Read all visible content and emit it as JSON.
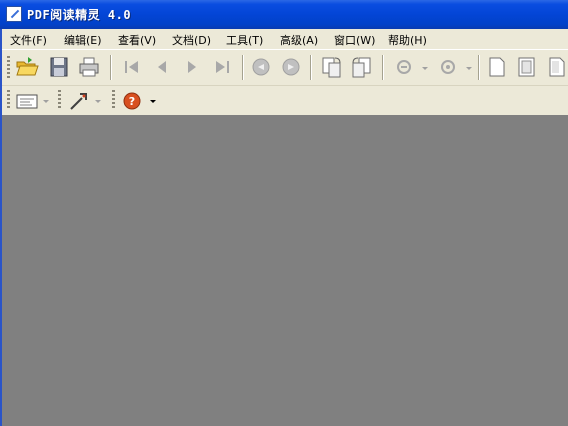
{
  "window": {
    "title": "PDF阅读精灵 4.0"
  },
  "menubar": {
    "items": [
      {
        "label": "文件(F)"
      },
      {
        "label": "编辑(E)"
      },
      {
        "label": "查看(V)"
      },
      {
        "label": "文档(D)"
      },
      {
        "label": "工具(T)"
      },
      {
        "label": "高级(A)"
      },
      {
        "label": "窗口(W)"
      },
      {
        "label": "帮助(H)"
      }
    ]
  },
  "icons": {
    "open": "folder-open-icon",
    "save": "save-icon",
    "print": "print-icon",
    "first_page": "first-page-icon",
    "prev_page": "prev-page-icon",
    "next_page": "next-page-icon",
    "last_page": "last-page-icon",
    "back": "back-icon",
    "forward": "forward-icon",
    "rotate_cw": "rotate-clockwise-icon",
    "rotate_ccw": "rotate-counterclockwise-icon",
    "zoom_out": "zoom-out-icon",
    "zoom_in": "zoom-in-icon",
    "single_page": "single-page-icon",
    "continuous": "continuous-page-icon",
    "facing": "facing-page-icon",
    "select_tool": "select-text-icon",
    "snapshot_tool": "snapshot-tool-icon",
    "help": "help-icon"
  },
  "colors": {
    "titlebar": "#0345d6",
    "chrome": "#ece9d8",
    "workspace": "#808080"
  }
}
